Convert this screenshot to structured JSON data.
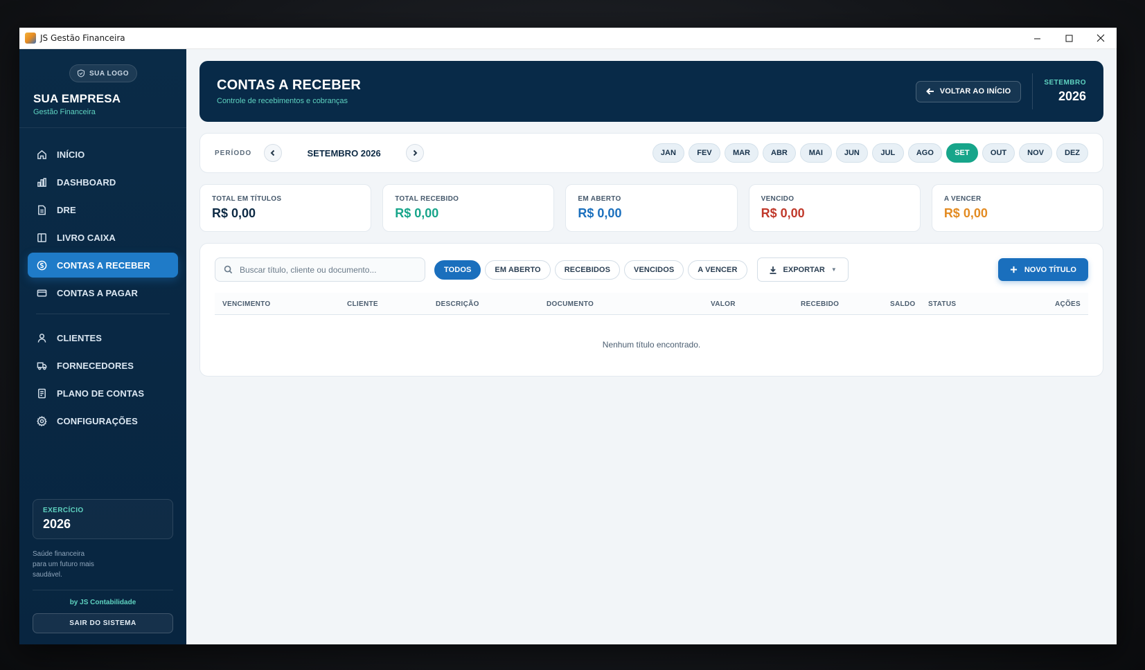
{
  "window": {
    "title": "JS Gestão Financeira",
    "minimize": "—",
    "maximize": "☐",
    "close": "✕"
  },
  "sidebar": {
    "logo_label": "SUA LOGO",
    "company_name": "SUA EMPRESA",
    "company_sub": "Gestão Financeira",
    "items": [
      {
        "label": "INÍCIO",
        "icon": "home-icon"
      },
      {
        "label": "DASHBOARD",
        "icon": "bar-chart-icon"
      },
      {
        "label": "DRE",
        "icon": "document-icon"
      },
      {
        "label": "LIVRO CAIXA",
        "icon": "book-icon"
      },
      {
        "label": "CONTAS A RECEBER",
        "icon": "coin-icon",
        "active": true
      },
      {
        "label": "CONTAS A PAGAR",
        "icon": "card-icon"
      },
      {
        "label": "CLIENTES",
        "icon": "user-icon"
      },
      {
        "label": "FORNECEDORES",
        "icon": "truck-icon"
      },
      {
        "label": "PLANO DE CONTAS",
        "icon": "list-icon"
      },
      {
        "label": "CONFIGURAÇÕES",
        "icon": "gear-icon"
      }
    ],
    "exercise_label": "EXERCÍCIO",
    "exercise_year": "2026",
    "tagline": "Saúde financeira para um futuro mais saudável.",
    "by_line": "by JS Contabilidade",
    "logout_label": "SAIR DO SISTEMA"
  },
  "header": {
    "title": "CONTAS A RECEBER",
    "subtitle": "Controle de recebimentos e cobranças",
    "back_label": "VOLTAR AO INÍCIO",
    "month": "SETEMBRO",
    "year": "2026"
  },
  "period": {
    "label": "PERÍODO",
    "value": "SETEMBRO 2026",
    "months": [
      "JAN",
      "FEV",
      "MAR",
      "ABR",
      "MAI",
      "JUN",
      "JUL",
      "AGO",
      "SET",
      "OUT",
      "NOV",
      "DEZ"
    ],
    "active_month": "SET"
  },
  "cards": [
    {
      "label": "TOTAL EM TÍTULOS",
      "value": "R$ 0,00",
      "color": "#0d2a44"
    },
    {
      "label": "TOTAL RECEBIDO",
      "value": "R$ 0,00",
      "color": "#17a58a"
    },
    {
      "label": "EM ABERTO",
      "value": "R$ 0,00",
      "color": "#1a6fbd"
    },
    {
      "label": "VENCIDO",
      "value": "R$ 0,00",
      "color": "#c0392b"
    },
    {
      "label": "A VENCER",
      "value": "R$ 0,00",
      "color": "#e38b22"
    }
  ],
  "toolbar": {
    "search_placeholder": "Buscar título, cliente ou documento...",
    "filters": [
      "TODOS",
      "EM ABERTO",
      "RECEBIDOS",
      "VENCIDOS",
      "A VENCER"
    ],
    "active_filter": "TODOS",
    "export_label": "EXPORTAR",
    "new_label": "NOVO TÍTULO"
  },
  "table": {
    "columns": [
      "VENCIMENTO",
      "CLIENTE",
      "DESCRIÇÃO",
      "DOCUMENTO",
      "VALOR",
      "RECEBIDO",
      "SALDO",
      "STATUS",
      "AÇÕES"
    ],
    "empty_message": "Nenhum título encontrado."
  },
  "colors": {
    "sidebar": "#0a2b47",
    "accent": "#1f7bc8",
    "teal": "#17a58a"
  }
}
